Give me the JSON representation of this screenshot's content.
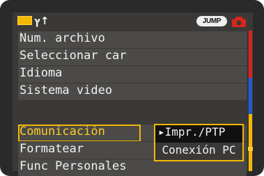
{
  "header": {
    "tools_glyph": "ץ↑",
    "jump_label": "JUMP",
    "icons": {
      "tools_tab": "folder-tab-icon",
      "wrench": "wrench-icon",
      "camera": "camera-icon"
    },
    "colors": {
      "tab": "#f5b800",
      "camera": "#d8261b"
    }
  },
  "menu": {
    "items": [
      {
        "label": "Num. archivo"
      },
      {
        "label": "Seleccionar car"
      },
      {
        "label": "Idioma"
      },
      {
        "label": "Sistema video"
      },
      {
        "label": "Comunicación",
        "selected": true
      },
      {
        "label": "Formatear"
      },
      {
        "label": "Func Personales"
      }
    ]
  },
  "popup": {
    "options": [
      {
        "label": "▸Impr./PTP",
        "active": true
      },
      {
        "label": "Conexión PC"
      }
    ]
  },
  "scrollbar": {
    "segment_colors": [
      "#d8261b",
      "#1f5bd6",
      "#f5b800"
    ],
    "position": 0.85
  }
}
